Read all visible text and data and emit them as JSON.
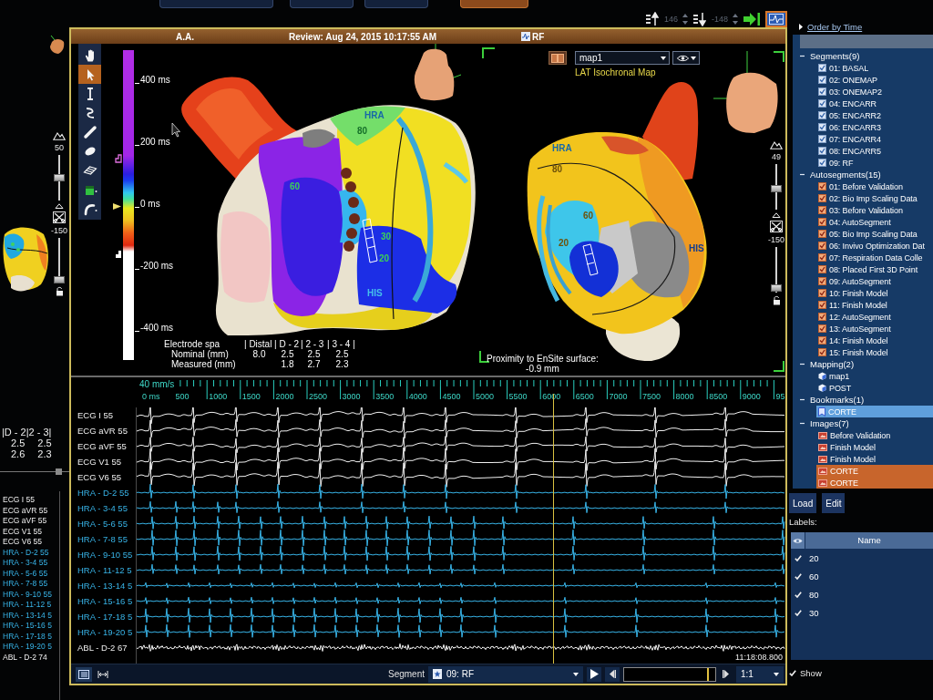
{
  "top_toolbar": {
    "buttons": [
      {
        "selected": false
      },
      {
        "selected": false
      },
      {
        "selected": false
      },
      {
        "selected": true
      }
    ]
  },
  "view_controls": {
    "upper_limit": {
      "value": "146",
      "disabled": true
    },
    "lower_limit": {
      "value": "-148",
      "disabled": true
    },
    "signal_view": {
      "selected": true
    }
  },
  "left_panel": {
    "sliders": [
      {
        "reading": "50",
        "level": 0.5
      },
      {
        "reading": "-150",
        "level": 0
      }
    ],
    "spacing": {
      "header": "|D - 2|2 - 3|",
      "rows": [
        [
          "2.5",
          "2.5"
        ],
        [
          "2.6",
          "2.3"
        ]
      ]
    },
    "channels": [
      {
        "label": "ECG I 55",
        "kind": "ecg"
      },
      {
        "label": "ECG aVR 55",
        "kind": "ecg"
      },
      {
        "label": "ECG aVF 55",
        "kind": "ecg"
      },
      {
        "label": "ECG V1 55",
        "kind": "ecg"
      },
      {
        "label": "ECG V6 55",
        "kind": "ecg"
      },
      {
        "label": "HRA - D-2 55",
        "kind": "hra"
      },
      {
        "label": "HRA - 3-4 55",
        "kind": "hra"
      },
      {
        "label": "HRA - 5-6 55",
        "kind": "hra"
      },
      {
        "label": "HRA - 7-8 55",
        "kind": "hra"
      },
      {
        "label": "HRA - 9-10 55",
        "kind": "hra"
      },
      {
        "label": "HRA - 11-12 5",
        "kind": "hra"
      },
      {
        "label": "HRA - 13-14 5",
        "kind": "hra"
      },
      {
        "label": "HRA - 15-16 5",
        "kind": "hra"
      },
      {
        "label": "HRA - 17-18 5",
        "kind": "hra"
      },
      {
        "label": "HRA - 19-20 5",
        "kind": "hra"
      },
      {
        "label": "ABL - D-2 74",
        "kind": "abl"
      }
    ]
  },
  "header": {
    "patient": "A.A.",
    "review": "Review: Aug 24, 2015 10:17:55 AM",
    "segment": "RF"
  },
  "map_view": {
    "tools": [
      {
        "selected": false
      },
      {
        "selected": true
      },
      {
        "selected": false
      },
      {
        "selected": false
      },
      {
        "selected": false
      },
      {
        "selected": false
      },
      {
        "selected": false
      },
      {
        "selected": false
      },
      {
        "selected": false
      }
    ],
    "color_scale": {
      "labels": [
        "400 ms",
        "200 ms",
        "0 ms",
        "-200 ms",
        "-400 ms"
      ]
    },
    "map_select": {
      "value": "map1"
    },
    "map_type": "LAT Isochronal Map",
    "views": [
      {
        "labels": [
          {
            "text": "HRA",
            "color": "#1768a8"
          },
          {
            "text": "80",
            "color": "#16702a"
          },
          {
            "text": "60",
            "color": "#3ccf5a"
          },
          {
            "text": "30",
            "color": "#3ccf5a"
          },
          {
            "text": "20",
            "color": "#3ccf5a"
          },
          {
            "text": "HIS",
            "color": "#45c0ea"
          }
        ]
      },
      {
        "labels": [
          {
            "text": "HRA",
            "color": "#1768a8"
          },
          {
            "text": "80",
            "color": "#6e520a"
          },
          {
            "text": "60",
            "color": "#6e520a"
          },
          {
            "text": "20",
            "color": "#6e520a"
          },
          {
            "text": "HIS",
            "color": "#103c90"
          }
        ]
      }
    ],
    "electrode_spacing": {
      "title": "Electrode spa",
      "headers": [
        "| Distal",
        "| D - 2",
        "| 2 - 3",
        "| 3 - 4 |"
      ],
      "rows": [
        {
          "label": "Nominal (mm)",
          "values": [
            "8.0",
            "2.5",
            "2.5",
            "2.5"
          ]
        },
        {
          "label": "Measured (mm)",
          "values": [
            "1.8",
            "2.7",
            "2.3"
          ]
        }
      ]
    },
    "proximity": {
      "label": "Proximity to EnSite surface:",
      "value": "-0.9 mm"
    },
    "sliders": [
      {
        "reading": "49",
        "level": 0.45
      },
      {
        "reading": "-150",
        "level": 0.03
      }
    ]
  },
  "signals": {
    "speed": "40 mm/s",
    "ruler": [
      "0 ms",
      "500",
      "1000",
      "1500",
      "2000",
      "2500",
      "3000",
      "3500",
      "4000",
      "4500",
      "5000",
      "5500",
      "6000",
      "6500",
      "7000",
      "7500",
      "8000",
      "8500",
      "9000",
      "95"
    ],
    "channels": [
      {
        "label": "ECG I 55",
        "kind": "ecg"
      },
      {
        "label": "ECG aVR 55",
        "kind": "ecg"
      },
      {
        "label": "ECG aVF 55",
        "kind": "ecg"
      },
      {
        "label": "ECG V1 55",
        "kind": "ecg"
      },
      {
        "label": "ECG V6 55",
        "kind": "ecg"
      },
      {
        "label": "HRA - D-2 55",
        "kind": "hra"
      },
      {
        "label": "HRA - 3-4 55",
        "kind": "hra"
      },
      {
        "label": "HRA - 5-6 55",
        "kind": "hra"
      },
      {
        "label": "HRA - 7-8 55",
        "kind": "hra"
      },
      {
        "label": "HRA - 9-10 55",
        "kind": "hra"
      },
      {
        "label": "HRA - 11-12 5",
        "kind": "hra"
      },
      {
        "label": "HRA - 13-14 5",
        "kind": "hra"
      },
      {
        "label": "HRA - 15-16 5",
        "kind": "hra"
      },
      {
        "label": "HRA - 17-18 5",
        "kind": "hra"
      },
      {
        "label": "HRA - 19-20 5",
        "kind": "hra"
      },
      {
        "label": "ABL - D-2 67",
        "kind": "abl"
      }
    ],
    "timestamp": "11:18:08.800"
  },
  "playback": {
    "segment_label": "Segment",
    "segment": "09: RF",
    "position": {
      "level": 0.93
    },
    "zoom": "1:1"
  },
  "sidebar": {
    "order_link": "Order by Time",
    "tree": [
      {
        "label": "Segments(9)",
        "expanded": true,
        "children": [
          {
            "label": "01: BASAL",
            "kind": "segment",
            "selected": false
          },
          {
            "label": "02: ONEMAP",
            "kind": "segment",
            "selected": false
          },
          {
            "label": "03: ONEMAP2",
            "kind": "segment",
            "selected": false
          },
          {
            "label": "04: ENCARR",
            "kind": "segment",
            "selected": false
          },
          {
            "label": "05: ENCARR2",
            "kind": "segment",
            "selected": false
          },
          {
            "label": "06: ENCARR3",
            "kind": "segment",
            "selected": false
          },
          {
            "label": "07: ENCARR4",
            "kind": "segment",
            "selected": false
          },
          {
            "label": "08: ENCARR5",
            "kind": "segment",
            "selected": false
          },
          {
            "label": "09: RF",
            "kind": "segment",
            "selected": false
          }
        ]
      },
      {
        "label": "Autosegments(15)",
        "expanded": true,
        "children": [
          {
            "label": "01: Before Validation",
            "kind": "autosegment",
            "selected": false
          },
          {
            "label": "02: Bio Imp Scaling Data",
            "kind": "autosegment",
            "selected": false
          },
          {
            "label": "03: Before Validation",
            "kind": "autosegment",
            "selected": false
          },
          {
            "label": "04: AutoSegment",
            "kind": "autosegment",
            "selected": false
          },
          {
            "label": "05: Bio Imp Scaling Data",
            "kind": "autosegment",
            "selected": false
          },
          {
            "label": "06: Invivo Optimization Dat",
            "kind": "autosegment",
            "selected": false
          },
          {
            "label": "07: Respiration Data Colle",
            "kind": "autosegment",
            "selected": false
          },
          {
            "label": "08: Placed First 3D Point",
            "kind": "autosegment",
            "selected": false
          },
          {
            "label": "09: AutoSegment",
            "kind": "autosegment",
            "selected": false
          },
          {
            "label": "10: Finish Model",
            "kind": "autosegment",
            "selected": false
          },
          {
            "label": "11: Finish Model",
            "kind": "autosegment",
            "selected": false
          },
          {
            "label": "12: AutoSegment",
            "kind": "autosegment",
            "selected": false
          },
          {
            "label": "13: AutoSegment",
            "kind": "autosegment",
            "selected": false
          },
          {
            "label": "14: Finish Model",
            "kind": "autosegment",
            "selected": false
          },
          {
            "label": "15: Finish Model",
            "kind": "autosegment",
            "selected": false
          }
        ]
      },
      {
        "label": "Mapping(2)",
        "expanded": true,
        "children": [
          {
            "label": "map1",
            "kind": "map",
            "selected": false
          },
          {
            "label": "POST",
            "kind": "map",
            "selected": false
          }
        ]
      },
      {
        "label": "Bookmarks(1)",
        "expanded": true,
        "children": [
          {
            "label": "CORTE",
            "kind": "bookmark",
            "selected": true
          }
        ]
      },
      {
        "label": "Images(7)",
        "expanded": true,
        "children": [
          {
            "label": "Before Validation",
            "kind": "image",
            "selected": false
          },
          {
            "label": "Finish Model",
            "kind": "image",
            "selected": false
          },
          {
            "label": "Finish Model",
            "kind": "image",
            "selected": false
          },
          {
            "label": "CORTE",
            "kind": "image",
            "selected": true
          },
          {
            "label": "CORTE",
            "kind": "image",
            "selected": true
          }
        ]
      }
    ],
    "buttons": [
      "Load",
      "Edit"
    ],
    "labels": {
      "title": "Labels:",
      "column": "Name",
      "rows": [
        {
          "name": "20",
          "checked": true
        },
        {
          "name": "60",
          "checked": true
        },
        {
          "name": "80",
          "checked": true
        },
        {
          "name": "30",
          "checked": true
        }
      ]
    },
    "show": {
      "label": "Show",
      "checked": true
    }
  }
}
